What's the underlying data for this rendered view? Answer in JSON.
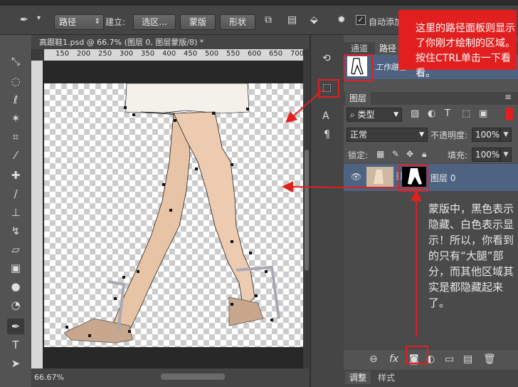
{
  "options_bar": {
    "tool_mode": "路径",
    "build_label": "建立:",
    "selection_button": "选区...",
    "mask_button": "蒙版",
    "shape_button": "形状",
    "auto_add_label": "自动添加"
  },
  "document": {
    "tab_title": "高跟鞋1.psd @ 66.7% (图层 0, 图层蒙版/8) *",
    "ruler_ticks": [
      "150",
      "200",
      "250",
      "300",
      "350",
      "400",
      "450",
      "500",
      "550",
      "600",
      "650",
      "700"
    ],
    "zoom": "66.67%"
  },
  "paths_panel": {
    "tabs": [
      "通道",
      "路径"
    ],
    "active_tab": "路径",
    "path_name": "工作路径"
  },
  "layers_panel": {
    "tab": "图层",
    "filter_kind": "类型",
    "blend_mode": "正常",
    "opacity_label": "不透明度:",
    "opacity_value": "100%",
    "lock_label": "锁定:",
    "fill_label": "填充:",
    "fill_value": "100%",
    "layer_name": "图层 0",
    "bottom_tabs": [
      "调整",
      "样式"
    ]
  },
  "annotations": {
    "paths_note": "这里的路径面板则显示了你刚才绘制的区域。按住CTRL单击一下看看。",
    "mask_note": "蒙版中，黑色表示隐藏、白色表示显示！所以，你看到的只有“大腿”部分，而其他区域其实是都隐藏起来了。"
  },
  "colors": {
    "accent_red": "#e21f1f",
    "note_bg": "#e21f1f",
    "selected_layer": "#4e6282"
  }
}
